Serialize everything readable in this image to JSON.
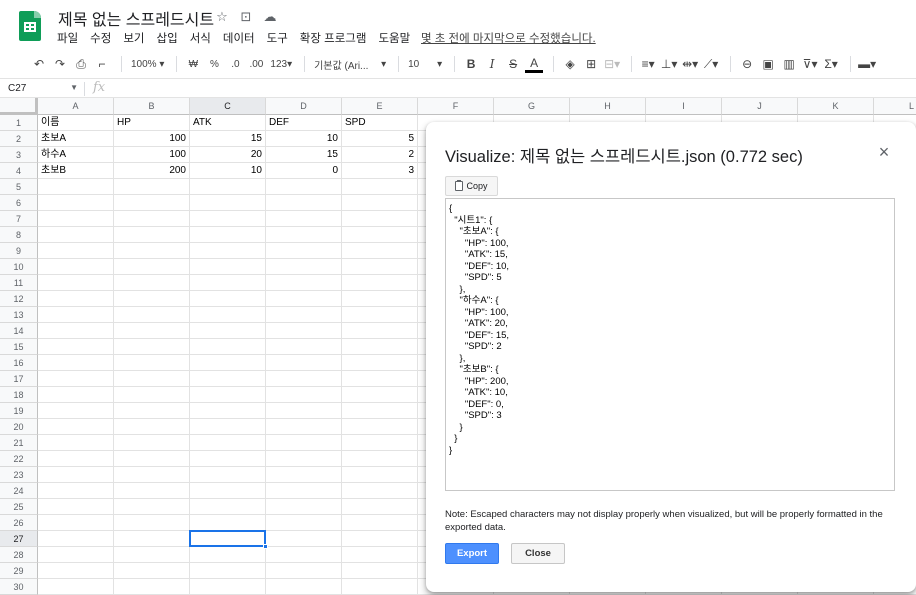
{
  "header": {
    "doc_title": "제목 없는 스프레드시트",
    "menu": [
      "파일",
      "수정",
      "보기",
      "삽입",
      "서식",
      "데이터",
      "도구",
      "확장 프로그램",
      "도움말"
    ],
    "last_edit": "몇 초 전에 마지막으로 수정했습니다."
  },
  "toolbar": {
    "zoom": "100%",
    "currency": "₩",
    "percent": "%",
    "dec_less": ".0",
    "dec_more": ".00",
    "number_format": "123",
    "font": "기본값 (Ari...",
    "font_size": "10",
    "bold": "B",
    "italic": "I",
    "strike": "S",
    "text_color": "A"
  },
  "formula_bar": {
    "cell_ref": "C27",
    "fx": "fx"
  },
  "grid": {
    "columns": [
      "A",
      "B",
      "C",
      "D",
      "E",
      "F",
      "G",
      "H",
      "I",
      "J",
      "K",
      "L"
    ],
    "rows": [
      "1",
      "2",
      "3",
      "4",
      "5",
      "6",
      "7",
      "8",
      "9",
      "10",
      "11",
      "12",
      "13",
      "14",
      "15",
      "16",
      "17",
      "18",
      "19",
      "20",
      "21",
      "22",
      "23",
      "24",
      "25",
      "26",
      "27",
      "28",
      "29",
      "30"
    ],
    "cells": {
      "A1": "이름",
      "B1": "HP",
      "C1": "ATK",
      "D1": "DEF",
      "E1": "SPD",
      "A2": "초보A",
      "B2": "100",
      "C2": "15",
      "D2": "10",
      "E2": "5",
      "A3": "하수A",
      "B3": "100",
      "C3": "20",
      "D3": "15",
      "E3": "2",
      "A4": "초보B",
      "B4": "200",
      "C4": "10",
      "D4": "0",
      "E4": "3"
    }
  },
  "dialog": {
    "title": "Visualize: 제목 없는 스프레드시트.json (0.772 sec)",
    "close_glyph": "×",
    "copy_label": "Copy",
    "json_text": "{\n  \"시트1\": {\n    \"초보A\": {\n      \"HP\": 100,\n      \"ATK\": 15,\n      \"DEF\": 10,\n      \"SPD\": 5\n    },\n    \"하수A\": {\n      \"HP\": 100,\n      \"ATK\": 20,\n      \"DEF\": 15,\n      \"SPD\": 2\n    },\n    \"초보B\": {\n      \"HP\": 200,\n      \"ATK\": 10,\n      \"DEF\": 0,\n      \"SPD\": 3\n    }\n  }\n}",
    "note": "Note: Escaped characters may not display properly when visualized, but will be properly formatted in the exported data.",
    "export_label": "Export",
    "close_label": "Close"
  },
  "colors": {
    "accent": "#1a73e8",
    "export_button": "#4d90fe",
    "sheets_green": "#0f9d58"
  },
  "icons": [
    "sheets-logo-icon",
    "star-icon",
    "move-folder-icon",
    "cloud-status-icon",
    "undo-icon",
    "redo-icon",
    "print-icon",
    "paint-format-icon",
    "fill-color-icon",
    "borders-icon",
    "merge-icon",
    "align-icon",
    "valign-icon",
    "wrap-icon",
    "rotate-icon",
    "link-icon",
    "comment-icon",
    "chart-icon",
    "filter-icon",
    "functions-icon",
    "keyboard-icon",
    "clipboard-icon",
    "close-icon"
  ]
}
